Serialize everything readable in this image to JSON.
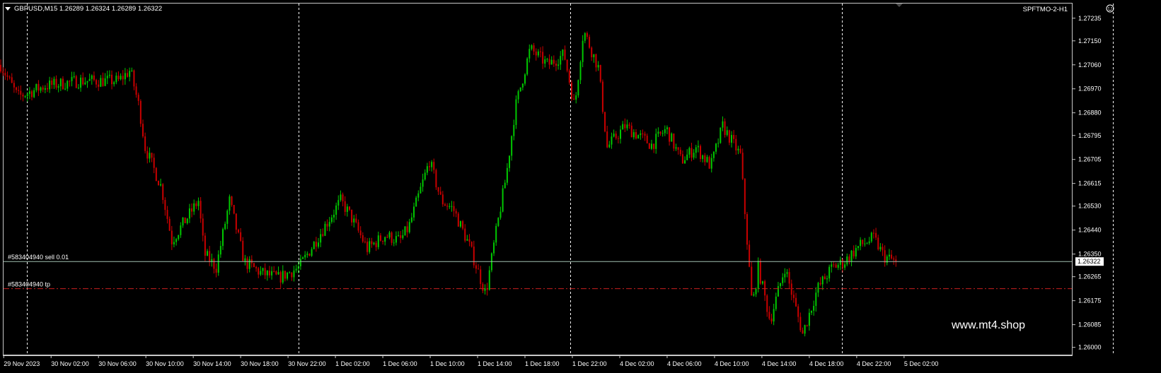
{
  "header": {
    "symbol_info": "GBPUSD,M15  1.26289 1.26324 1.26289 1.26322",
    "account": "SPFTMO-2-H1"
  },
  "orders": {
    "sell_label": "#583404940 sell 0.01",
    "tp_label": "#583404940 tp"
  },
  "current_price_label": "1.26322",
  "watermark": "www.mt4.shop",
  "icons": {
    "menu": "triangle-down-icon",
    "ea": "smiley-face-icon"
  },
  "colors": {
    "background": "#000000",
    "bull": "#00c800",
    "bear": "#c80000",
    "grid": "#ffffff",
    "order_line": "#9fbfb0",
    "tp_line": "#c81e1e"
  },
  "chart_data": {
    "type": "candlestick",
    "symbol": "GBPUSD",
    "timeframe": "M15",
    "ylim": [
      1.2597,
      1.2729
    ],
    "y_ticks": [
      1.27235,
      1.2715,
      1.2706,
      1.2697,
      1.2688,
      1.26795,
      1.26705,
      1.26615,
      1.2653,
      1.2644,
      1.2635,
      1.26265,
      1.26175,
      1.26085,
      1.26
    ],
    "y_tick_labels": [
      "1.27235",
      "1.27150",
      "1.27060",
      "1.26970",
      "1.26880",
      "1.26795",
      "1.26705",
      "1.26615",
      "1.26530",
      "1.26440",
      "1.26350",
      "1.26265",
      "1.26175",
      "1.26085",
      "1.26000"
    ],
    "x_tick_labels": [
      "29 Nov 2023",
      "30 Nov 02:00",
      "30 Nov 06:00",
      "30 Nov 10:00",
      "30 Nov 14:00",
      "30 Nov 18:00",
      "30 Nov 22:00",
      "1 Dec 02:00",
      "1 Dec 06:00",
      "1 Dec 10:00",
      "1 Dec 14:00",
      "1 Dec 18:00",
      "1 Dec 22:00",
      "4 Dec 02:00",
      "4 Dec 06:00",
      "4 Dec 10:00",
      "4 Dec 14:00",
      "4 Dec 18:00",
      "4 Dec 22:00",
      "5 Dec 02:00"
    ],
    "grid": "vertical day separators (dashed)",
    "day_separators": [
      "30 Nov 00:00",
      "1 Dec 00:00",
      "4 Dec 00:00",
      "5 Dec 00:00"
    ],
    "sell_price": 1.26322,
    "tp_price": 1.2622,
    "current_price": 1.26322,
    "anchors_x": [
      1,
      24,
      60,
      108,
      160,
      176,
      188,
      196,
      218,
      232,
      268,
      276,
      292,
      310,
      330,
      352,
      376,
      404,
      460,
      472,
      496,
      520,
      540,
      552,
      580,
      596,
      612,
      634,
      656,
      668,
      684,
      696,
      716,
      740,
      762,
      776,
      788,
      808,
      820,
      844,
      880,
      900,
      920,
      940,
      960,
      976,
      1000,
      1016,
      1024,
      1040,
      1060,
      1084,
      1104,
      1124,
      1140,
      1160,
      1180,
      1194,
      1210
    ],
    "anchors_close": [
      1.2706,
      1.2694,
      1.2698,
      1.27,
      1.27,
      1.2704,
      1.269,
      1.2675,
      1.266,
      1.264,
      1.2655,
      1.2635,
      1.263,
      1.2655,
      1.2632,
      1.2628,
      1.2626,
      1.263,
      1.2655,
      1.265,
      1.2637,
      1.2642,
      1.264,
      1.2645,
      1.267,
      1.2655,
      1.2652,
      1.2638,
      1.262,
      1.264,
      1.2665,
      1.269,
      1.2712,
      1.2706,
      1.271,
      1.269,
      1.2719,
      1.2705,
      1.2675,
      1.2683,
      1.2676,
      1.2682,
      1.267,
      1.2675,
      1.2668,
      1.2683,
      1.2672,
      1.2615,
      1.263,
      1.261,
      1.263,
      1.2605,
      1.2622,
      1.263,
      1.2632,
      1.2638,
      1.2641,
      1.2634,
      1.26322
    ]
  }
}
